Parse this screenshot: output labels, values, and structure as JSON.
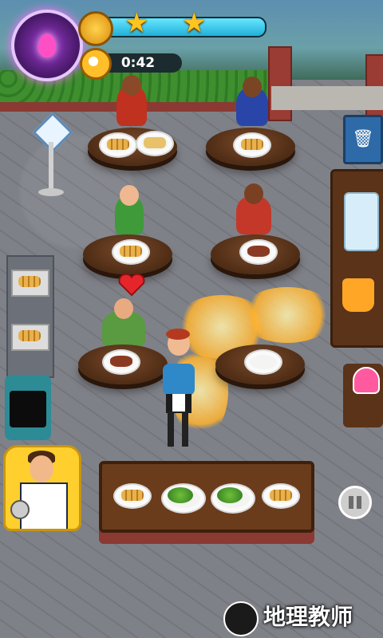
{
  "hud": {
    "timer": "0:42",
    "progress_percent": 100,
    "stars_earned": 2,
    "powerup_icon": "pink-flame-icon",
    "coin_icon": "coin-icon",
    "clock_icon": "alarm-clock-icon"
  },
  "scene": {
    "tables": [
      {
        "id": "table-1",
        "orders": [
          "fries",
          "sandwich"
        ]
      },
      {
        "id": "table-2",
        "orders": [
          "fries"
        ]
      },
      {
        "id": "table-3",
        "orders": [
          "steak-fries"
        ]
      },
      {
        "id": "table-4",
        "orders": [
          "egg-bacon"
        ]
      },
      {
        "id": "table-5",
        "orders": [
          "steak-salad"
        ]
      },
      {
        "id": "table-6",
        "orders": [
          "empty-plate"
        ]
      }
    ],
    "serving_counter_items": [
      "fries",
      "salad",
      "salad",
      "fries"
    ],
    "left_tray_items": [
      "fries",
      "fries"
    ],
    "colors": {
      "hud_bar": "#1fb0d8",
      "star": "#ffc41f",
      "powerup": "#9d3bd0",
      "heart": "#e5252a"
    }
  },
  "controls": {
    "pause_icon": "pause-icon",
    "trash_icon": "trash-icon",
    "refresh_sign_icon": "refresh-icon"
  },
  "watermark": {
    "text": "地理教师"
  }
}
